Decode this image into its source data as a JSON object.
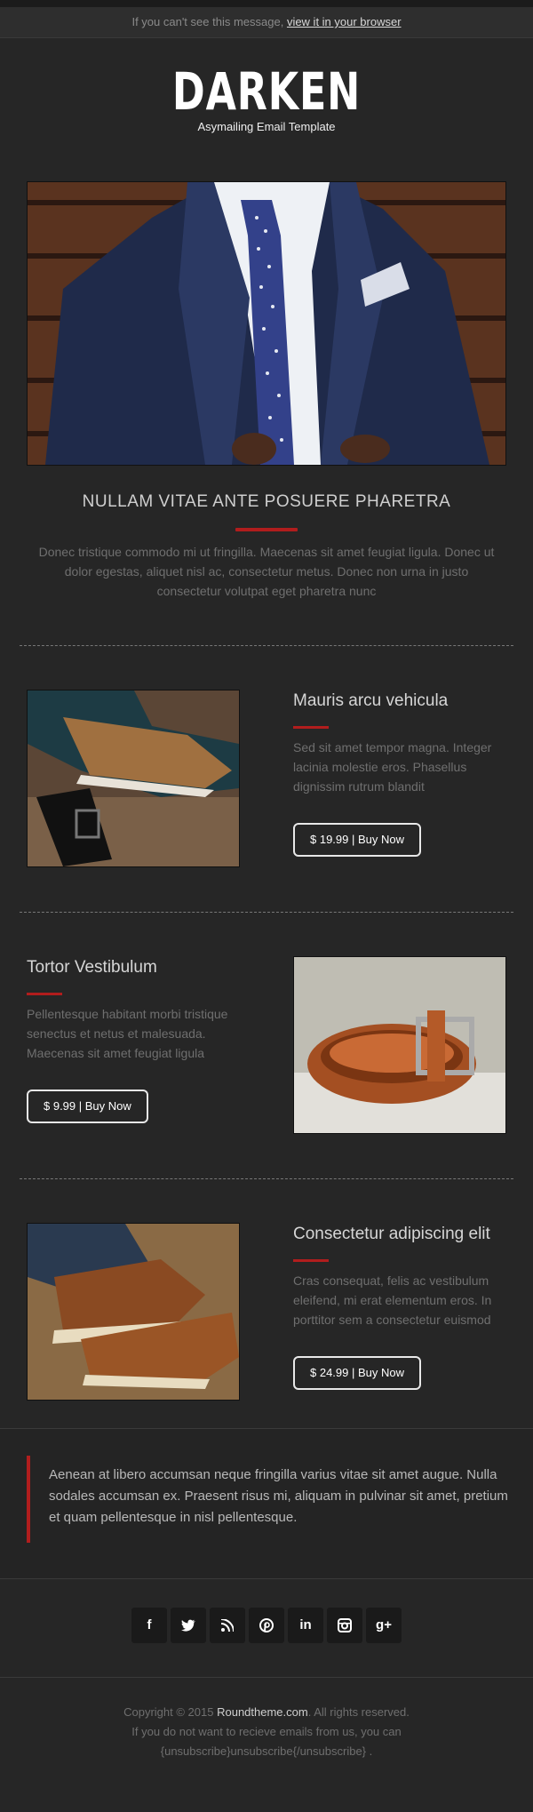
{
  "preheader": {
    "text": "If you can't see this message,",
    "link": "view it in your browser"
  },
  "header": {
    "logo": "DARKEN",
    "tagline": "Asymailing Email Template"
  },
  "hero": {
    "title": "NULLAM VITAE ANTE POSUERE PHARETRA",
    "text": "Donec tristique commodo mi ut fringilla. Maecenas sit amet feugiat ligula. Donec ut dolor egestas, aliquet nisl ac, consectetur metus. Donec non urna in justo consectetur volutpat eget pharetra nunc"
  },
  "products": [
    {
      "title": "Mauris arcu vehicula",
      "desc": "Sed sit amet tempor magna. Integer lacinia molestie eros. Phasellus dignissim rutrum blandit",
      "button": "$ 19.99 | Buy Now"
    },
    {
      "title": "Tortor Vestibulum",
      "desc": "Pellentesque habitant morbi tristique senectus et netus et malesuada. Maecenas sit amet feugiat ligula",
      "button": "$ 9.99 | Buy Now"
    },
    {
      "title": "Consectetur adipiscing elit",
      "desc": "Cras consequat, felis ac vestibulum eleifend, mi erat elementum eros. In porttitor sem a consectetur euismod",
      "button": "$ 24.99 | Buy Now"
    }
  ],
  "quote": {
    "text": "Aenean at libero accumsan neque fringilla varius vitae sit amet augue. Nulla sodales accumsan ex. Praesent risus mi, aliquam in pulvinar sit amet, pretium et quam pellentesque in nisl pellentesque."
  },
  "social": {
    "facebook": "f",
    "twitter": "t",
    "rss": "rss",
    "pinterest": "p",
    "linkedin": "in",
    "instagram": "ig",
    "googleplus": "g+"
  },
  "footer": {
    "copyright_prefix": "Copyright © 2015",
    "site": "Roundtheme.com",
    "copyright_suffix": ". All rights reserved.",
    "line2": "If you do not want to recieve emails from us, you can",
    "line3": "{unsubscribe}unsubscribe{/unsubscribe} ."
  },
  "colors": {
    "background": "#262626",
    "accent": "#b11d1d",
    "text_muted": "#6f6f6f"
  }
}
